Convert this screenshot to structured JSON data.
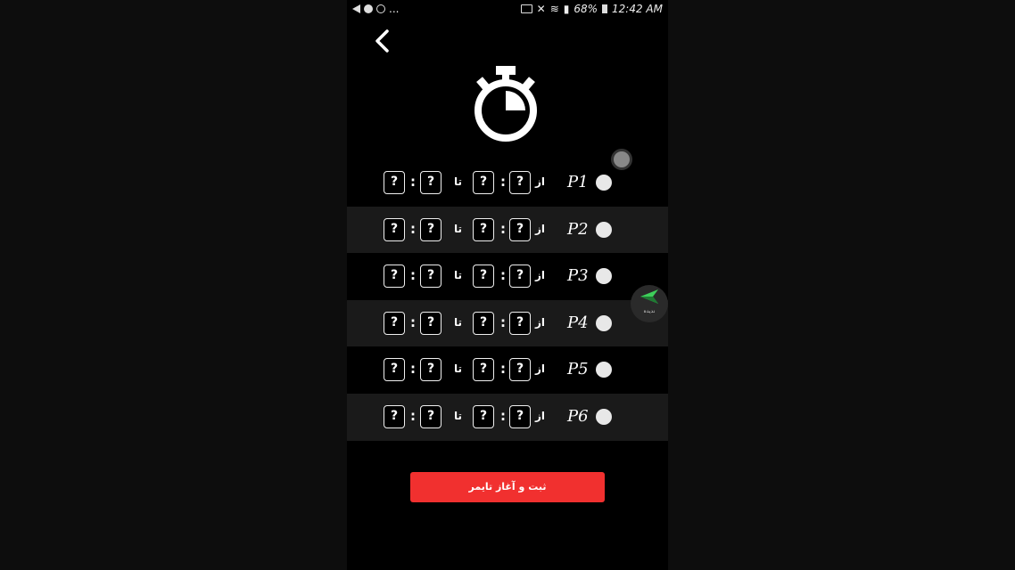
{
  "status_bar": {
    "more": "...",
    "battery": "68%",
    "time": "12:42 AM"
  },
  "icons": {
    "back": "chevron-left-icon",
    "timer": "stopwatch-icon",
    "floating": "send-arrow-icon"
  },
  "colors": {
    "background": "#000000",
    "alt_row": "#1a1a1a",
    "accent": "#f1302f",
    "floating_arrow": "#3ecf5a"
  },
  "rows": [
    {
      "label": "P1",
      "from_word": "از",
      "to_word": "تا",
      "fields": [
        "?",
        "?",
        "?",
        "?"
      ],
      "colon": ":"
    },
    {
      "label": "P2",
      "from_word": "از",
      "to_word": "تا",
      "fields": [
        "?",
        "?",
        "?",
        "?"
      ],
      "colon": ":"
    },
    {
      "label": "P3",
      "from_word": "از",
      "to_word": "تا",
      "fields": [
        "?",
        "?",
        "?",
        "?"
      ],
      "colon": ":"
    },
    {
      "label": "P4",
      "from_word": "از",
      "to_word": "تا",
      "fields": [
        "?",
        "?",
        "?",
        "?"
      ],
      "colon": ":"
    },
    {
      "label": "P5",
      "from_word": "از",
      "to_word": "تا",
      "fields": [
        "?",
        "?",
        "?",
        "?"
      ],
      "colon": ":"
    },
    {
      "label": "P6",
      "from_word": "از",
      "to_word": "تا",
      "fields": [
        "?",
        "?",
        "?",
        "?"
      ],
      "colon": ":"
    }
  ],
  "floating_button": {
    "label": "ندیده"
  },
  "submit_button": {
    "label": "ثبت و آغاز تایمر"
  }
}
